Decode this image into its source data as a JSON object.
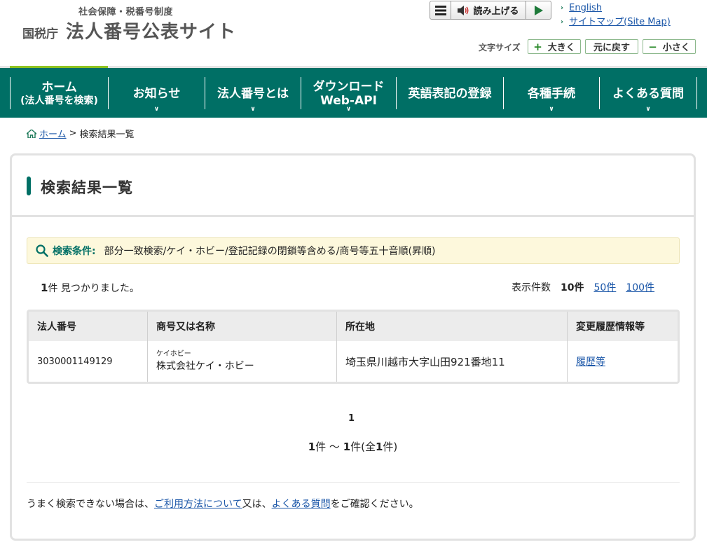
{
  "header": {
    "logo_sub": "社会保障・税番号制度",
    "logo_agency": "国税庁",
    "logo_main": "法人番号公表サイト",
    "read_aloud": "読み上げる",
    "link_english": "English",
    "link_sitemap": "サイトマップ(Site Map)",
    "font_size_label": "文字サイズ",
    "font_larger": "大きく",
    "font_reset": "元に戻す",
    "font_smaller": "小さく"
  },
  "nav": {
    "items": [
      {
        "line1": "ホーム",
        "line2": "(法人番号を検索)"
      },
      {
        "line1": "お知らせ"
      },
      {
        "line1": "法人番号とは"
      },
      {
        "line1": "ダウンロード",
        "line2": "Web-API"
      },
      {
        "line1": "英語表記の登録"
      },
      {
        "line1": "各種手続"
      },
      {
        "line1": "よくある質問"
      }
    ]
  },
  "breadcrumb": {
    "home": "ホーム",
    "separator": ">",
    "current": "検索結果一覧"
  },
  "main": {
    "title": "検索結果一覧",
    "condition_label": "検索条件:",
    "condition_value": "部分一致検索/ケイ・ホビー/登記記録の閉鎖等含める/商号等五十音順(昇順)",
    "found_count": "1",
    "found_text": "件 見つかりました。",
    "per_page_label": "表示件数",
    "per_page_current": "10件",
    "per_page_50": "50件",
    "per_page_100": "100件",
    "table": {
      "headers": [
        "法人番号",
        "商号又は名称",
        "所在地",
        "変更履歴情報等"
      ],
      "rows": [
        {
          "number": "3030001149129",
          "kana": "ケイホビー",
          "name": "株式会社ケイ・ホビー",
          "address": "埼玉県川越市大字山田921番地11",
          "history": "履歴等"
        }
      ]
    },
    "page_number": "1",
    "range_from": "1",
    "range_mid": "件 ～ ",
    "range_to": "1",
    "range_end": "件(全",
    "range_total": "1",
    "range_close": "件)",
    "footnote_pre": "うまく検索できない場合は、",
    "footnote_link1": "ご利用方法について",
    "footnote_mid": "又は、",
    "footnote_link2": "よくある質問",
    "footnote_post": "をご確認ください。"
  },
  "colors": {
    "nav_bg": "#006f65",
    "accent_green": "#8fc31f",
    "condition_bg": "#fdf8dc",
    "link": "#1a56a8"
  }
}
